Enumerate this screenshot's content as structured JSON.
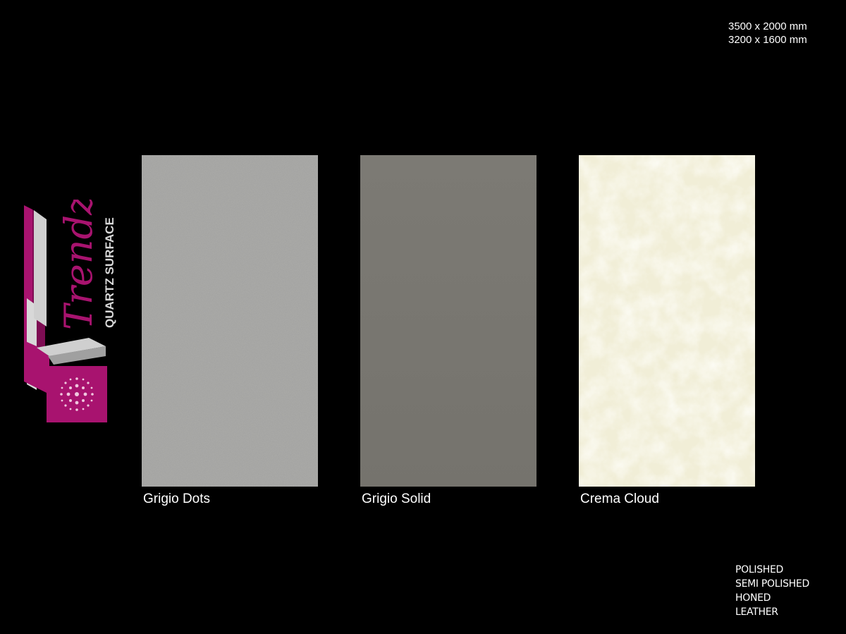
{
  "brand": {
    "name": "Trendz",
    "tagline": "QUARTZ SURFACE",
    "accent_color": "#a8136f",
    "secondary_color": "#b8b8b8",
    "icon": "trendz-logo-icon"
  },
  "sizes": [
    "3500 x 2000 mm",
    "3200 x 1600 mm"
  ],
  "swatches": [
    {
      "name": "Grigio Dots",
      "color": "#a9a9a7"
    },
    {
      "name": "Grigio Solid",
      "color": "#787670"
    },
    {
      "name": "Crema Cloud",
      "color": "#f3f0da"
    }
  ],
  "finishes": [
    "POLISHED",
    "SEMI POLISHED",
    "HONED",
    "LEATHER"
  ]
}
